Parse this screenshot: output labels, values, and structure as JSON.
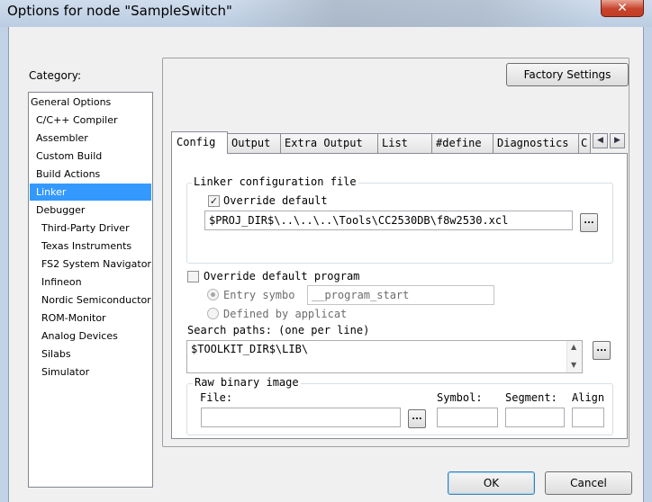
{
  "window": {
    "title": "Options for node \"SampleSwitch\"",
    "close_glyph": "✕"
  },
  "category": {
    "label": "Category:",
    "items": [
      {
        "label": "General Options"
      },
      {
        "label": "C/C++ Compiler"
      },
      {
        "label": "Assembler"
      },
      {
        "label": "Custom Build"
      },
      {
        "label": "Build Actions"
      },
      {
        "label": "Linker"
      },
      {
        "label": "Debugger"
      },
      {
        "label": "Third-Party Driver"
      },
      {
        "label": "Texas Instruments"
      },
      {
        "label": "FS2 System Navigator"
      },
      {
        "label": "Infineon"
      },
      {
        "label": "Nordic Semiconductor"
      },
      {
        "label": "ROM-Monitor"
      },
      {
        "label": "Analog Devices"
      },
      {
        "label": "Silabs"
      },
      {
        "label": "Simulator"
      }
    ],
    "selected": "Linker"
  },
  "factory_settings_label": "Factory Settings",
  "tabs": [
    {
      "label": "Config"
    },
    {
      "label": "Output"
    },
    {
      "label": "Extra Output"
    },
    {
      "label": "List"
    },
    {
      "label": "#define"
    },
    {
      "label": "Diagnostics"
    },
    {
      "label": "C"
    }
  ],
  "active_tab": "Config",
  "tab_scroll": {
    "left": "◀",
    "right": "▶"
  },
  "config": {
    "linker_config": {
      "title": "Linker configuration file",
      "override_label": "Override default",
      "override_checked": true,
      "check_glyph": "✓",
      "path": "$PROJ_DIR$\\..\\..\\..\\Tools\\CC2530DB\\f8w2530.xcl",
      "browse_label": "..."
    },
    "override_program": {
      "label": "Override default program",
      "checked": false,
      "entry_symbol_label": "Entry symbo",
      "entry_symbol_value": "__program_start",
      "defined_by_label": "Defined by applicat"
    },
    "search_paths": {
      "label": "Search paths:  (one per line)",
      "value": "$TOOLKIT_DIR$\\LIB\\",
      "browse_label": "...",
      "scroll_up": "▲",
      "scroll_down": "▼"
    },
    "raw_binary": {
      "title": "Raw binary image",
      "file_label": "File:",
      "file_value": "",
      "browse_label": "...",
      "symbol_label": "Symbol:",
      "symbol_value": "",
      "segment_label": "Segment:",
      "segment_value": "",
      "align_label": "Align",
      "align_value": ""
    }
  },
  "buttons": {
    "ok": "OK",
    "cancel": "Cancel"
  }
}
